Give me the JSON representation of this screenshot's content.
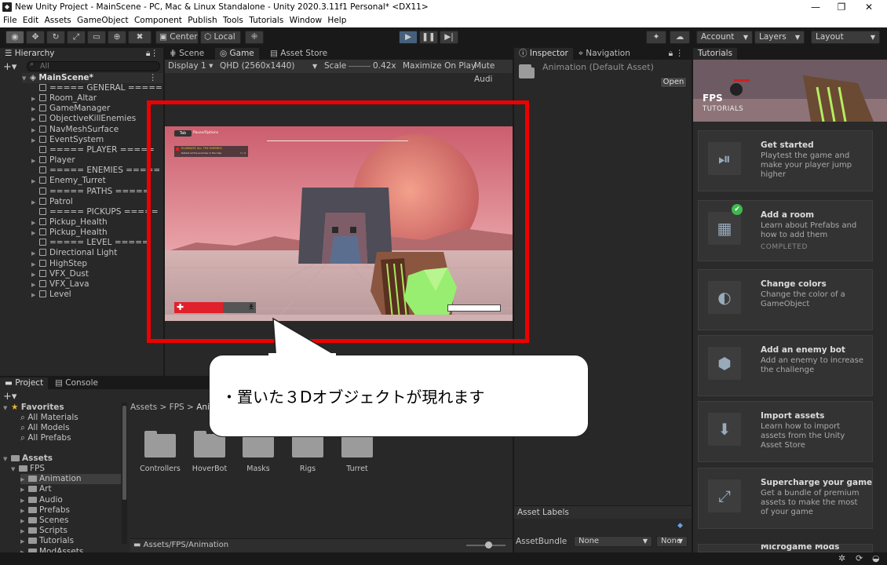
{
  "window": {
    "title": "New Unity Project - MainScene - PC, Mac & Linux Standalone - Unity 2020.3.11f1 Personal* <DX11>",
    "controls": [
      "—",
      "❐",
      "✕"
    ]
  },
  "menu": [
    "File",
    "Edit",
    "Assets",
    "GameObject",
    "Component",
    "Publish",
    "Tools",
    "Tutorials",
    "Window",
    "Help"
  ],
  "toolbar": {
    "pivot": "Center",
    "space": "Local",
    "account": "Account",
    "layers": "Layers",
    "layout": "Layout"
  },
  "hierarchy": {
    "tab": "Hierarchy",
    "search_placeholder": "All",
    "scene": "MainScene*",
    "items": [
      "===== GENERAL =====",
      "Room_Altar",
      "GameManager",
      "ObjectiveKillEnemies",
      "NavMeshSurface",
      "EventSystem",
      "===== PLAYER =====",
      "Player",
      "===== ENEMIES =====",
      "Enemy_Turret",
      "===== PATHS =====",
      "Patrol",
      "===== PICKUPS =====",
      "Pickup_Health",
      "Pickup_Health",
      "===== LEVEL =====",
      "Directional Light",
      "HighStep",
      "VFX_Dust",
      "VFX_Lava",
      "Level"
    ]
  },
  "game_view": {
    "tabs": [
      "Scene",
      "Game",
      "Asset Store"
    ],
    "display": "Display 1",
    "resolution": "QHD (2560x1440)",
    "scale_label": "Scale",
    "scale_value": "0.42x",
    "maximize": "Maximize On Play",
    "mute": "Mute Audi",
    "hud_tab": "Tab",
    "hud_pause": "Pause/Options",
    "hud_objective": "ELIMINATE ALL THE ENEMIES",
    "hud_objective_sub": "Defeat all the enemies in the map",
    "hud_objective_count": "1 / 4",
    "health_fraction": 0.6
  },
  "inspector": {
    "tabs": [
      "Inspector",
      "Navigation"
    ],
    "asset": "Animation (Default Asset)",
    "open": "Open",
    "asset_labels": "Asset Labels",
    "asset_bundle": "AssetBundle",
    "bundle_value": "None",
    "variant_value": "None"
  },
  "tutorials": {
    "tab": "Tutorials",
    "header_title": "FPS",
    "header_sub": "TUTORIALS",
    "cards": [
      {
        "title": "Get started",
        "desc": "Playtest the game and make your player jump higher",
        "status": ""
      },
      {
        "title": "Add a room",
        "desc": "Learn about Prefabs and how to add them",
        "status": "COMPLETED"
      },
      {
        "title": "Change colors",
        "desc": "Change the color of a GameObject",
        "status": ""
      },
      {
        "title": "Add an enemy bot",
        "desc": "Add an enemy to increase the challenge",
        "status": ""
      },
      {
        "title": "Import assets",
        "desc": "Learn how to import assets from the Unity Asset Store",
        "status": ""
      },
      {
        "title": "Supercharge your game",
        "desc": "Get a bundle of premium assets to make the most of your game",
        "status": ""
      }
    ],
    "partial_card": "Microgame Mods"
  },
  "project": {
    "tabs": [
      "Project",
      "Console"
    ],
    "favorites": "Favorites",
    "fav_items": [
      "All Materials",
      "All Models",
      "All Prefabs"
    ],
    "assets": "Assets",
    "tree": [
      "FPS",
      "Animation",
      "Art",
      "Audio",
      "Prefabs",
      "Scenes",
      "Scripts",
      "Tutorials",
      "ModAssets"
    ],
    "breadcrumb": [
      "Assets",
      "FPS",
      "Anim"
    ],
    "folders": [
      "Controllers",
      "HoverBot",
      "Masks",
      "Rigs",
      "Turret"
    ],
    "path": "Assets/FPS/Animation"
  },
  "callout": {
    "text": "・置いた３Dオブジェクトが現れます"
  }
}
